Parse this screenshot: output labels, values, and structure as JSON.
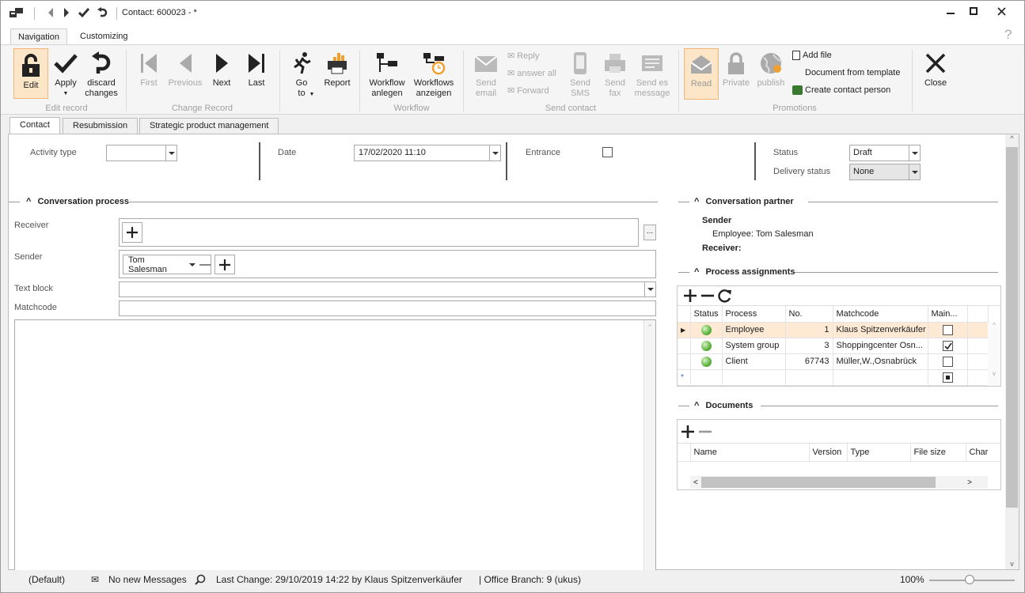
{
  "titlebar": {
    "title": "Contact: 600023 -  *"
  },
  "ribbon_tabs": [
    "Navigation",
    "Customizing"
  ],
  "ribbon": {
    "edit": "Edit",
    "apply": "Apply",
    "discard": "discard changes",
    "group_edit_record": "Edit record",
    "first": "First",
    "previous": "Previous",
    "next": "Next",
    "last": "Last",
    "group_change_record": "Change Record",
    "goto": "Go to",
    "report": "Report",
    "workflow_create": "Workflow anlegen",
    "workflows_show": "Workflows anzeigen",
    "group_workflow": "Workflow",
    "send_email": "Send email",
    "reply": "Reply",
    "answer_all": "answer all",
    "forward": "Forward",
    "send_sms": "Send SMS",
    "send_fax": "Send fax",
    "send_es_message": "Send es message",
    "group_send_contact": "Send contact",
    "read": "Read",
    "private": "Private",
    "publish": "publish",
    "add_file": "Add file",
    "document_from_template": "Document from template",
    "create_contact_person": "Create contact person",
    "group_promotions": "Promotions",
    "close": "Close"
  },
  "form_tabs": [
    "Contact",
    "Resubmission",
    "Strategic product management"
  ],
  "fields": {
    "activity_type_label": "Activity type",
    "activity_type_value": "",
    "date_label": "Date",
    "date_value": "17/02/2020 11:10",
    "entrance_label": "Entrance",
    "status_label": "Status",
    "status_value": "Draft",
    "delivery_status_label": "Delivery status",
    "delivery_status_value": "None"
  },
  "conversation": {
    "header": "Conversation process",
    "receiver_label": "Receiver",
    "sender_label": "Sender",
    "sender_value": "Tom Salesman",
    "text_block_label": "Text block",
    "matchcode_label": "Matchcode",
    "ellipsis": "..."
  },
  "partner": {
    "header": "Conversation partner",
    "sender_heading": "Sender",
    "sender_value": "Employee: Tom Salesman",
    "receiver_heading": "Receiver:"
  },
  "process": {
    "header": "Process assignments",
    "columns": [
      "Status",
      "Process",
      "No.",
      "Matchcode",
      "Main..."
    ],
    "rows": [
      {
        "process": "Employee",
        "no": "1",
        "matchcode": "Klaus Spitzenverkäufer",
        "main": false
      },
      {
        "process": "System group",
        "no": "3",
        "matchcode": "Shoppingcenter Osn...",
        "main": true
      },
      {
        "process": "Client",
        "no": "67743",
        "matchcode": "Müller,W.,Osnabrück",
        "main": false
      }
    ]
  },
  "documents": {
    "header": "Documents",
    "columns": [
      "Name",
      "Version",
      "Type",
      "File size",
      "Char"
    ]
  },
  "statusbar": {
    "default": "(Default)",
    "messages": "No new Messages",
    "last_change": "Last Change: 29/10/2019 14:22 by Klaus Spitzenverkäufer",
    "office_branch": "| Office Branch:  9 (ukus)",
    "zoom": "100%"
  },
  "colors": {
    "highlight": "#fde6c8",
    "selected_row": "#fde9d4",
    "status_green": "#5cb23c"
  }
}
